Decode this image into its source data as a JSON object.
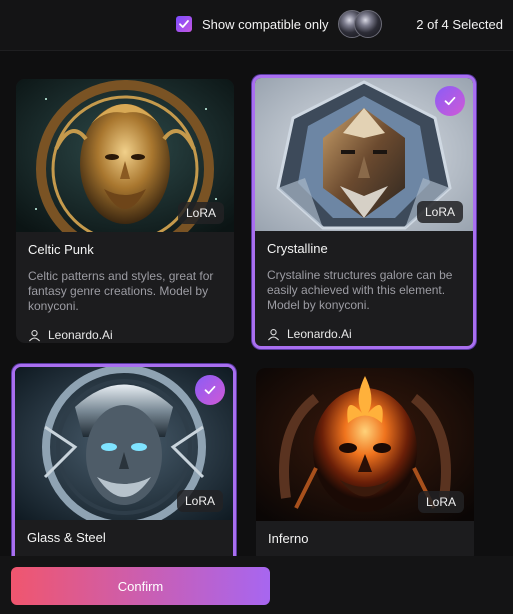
{
  "header": {
    "show_compatible_label": "Show compatible only",
    "show_compatible_checked": true,
    "selected_count": "2 of 4 Selected"
  },
  "elements": [
    {
      "title": "Celtic Punk",
      "badge": "LoRA",
      "description": "Celtic patterns and styles, great for fantasy genre creations. Model by konyconi.",
      "author": "Leonardo.Ai",
      "selected": false
    },
    {
      "title": "Crystalline",
      "badge": "LoRA",
      "description": "Crystaline structures galore can be easily achieved with this element. Model by konyconi.",
      "author": "Leonardo.Ai",
      "selected": true
    },
    {
      "title": "Glass & Steel",
      "badge": "LoRA",
      "selected": true
    },
    {
      "title": "Inferno",
      "badge": "LoRA",
      "selected": false
    }
  ],
  "footer": {
    "confirm_label": "Confirm"
  },
  "colors": {
    "accent_start": "#f0566e",
    "accent_end": "#a766f0",
    "selected_border": "#a96ff0"
  }
}
